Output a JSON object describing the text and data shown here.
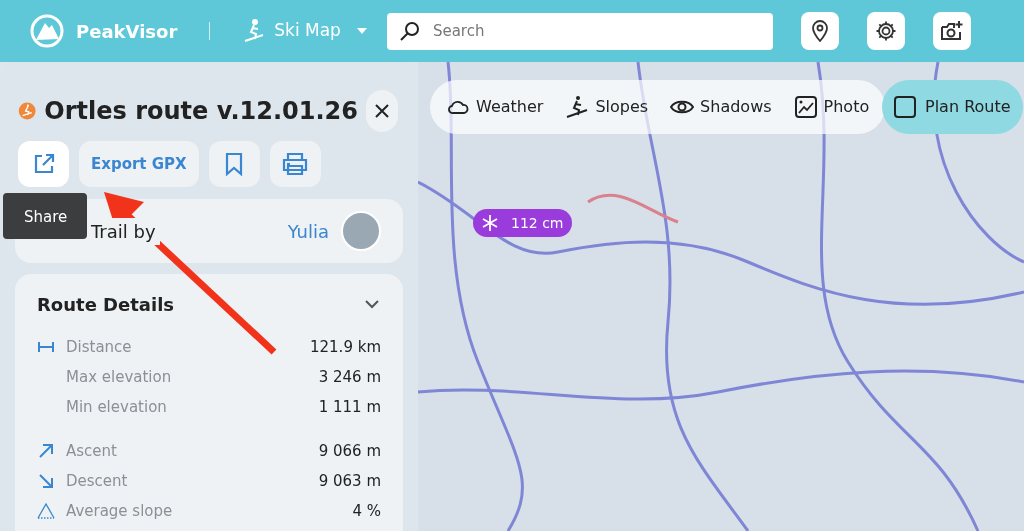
{
  "header": {
    "brand": "PeakVisor",
    "mode": "Ski Map",
    "search": {
      "placeholder": "Search"
    }
  },
  "route_panel": {
    "title": "Ortles route v.12.01.26",
    "export_button": "Export GPX",
    "tooltip": "Share",
    "trail_by": {
      "label": "Trail by",
      "author": "Yulia"
    },
    "details": {
      "title": "Route Details",
      "rows": [
        {
          "kind": "distance",
          "label": "Distance",
          "value": "121.9 km"
        },
        {
          "kind": "plain",
          "label": "Max elevation",
          "value": "3 246 m"
        },
        {
          "kind": "plain",
          "label": "Min elevation",
          "value": "1 111 m"
        },
        {
          "kind": "ascent",
          "label": "Ascent",
          "value": "9 066 m"
        },
        {
          "kind": "descent",
          "label": "Descent",
          "value": "9 063 m"
        },
        {
          "kind": "slope",
          "label": "Average slope",
          "value": "4 %"
        }
      ]
    }
  },
  "map": {
    "layers": [
      {
        "kind": "weather",
        "label": "Weather"
      },
      {
        "kind": "slopes",
        "label": "Slopes"
      },
      {
        "kind": "shadows",
        "label": "Shadows"
      },
      {
        "kind": "photo",
        "label": "Photo"
      }
    ],
    "plan_route": {
      "label": "Plan Route",
      "checked": false
    },
    "snow_badge": "112 cm"
  }
}
